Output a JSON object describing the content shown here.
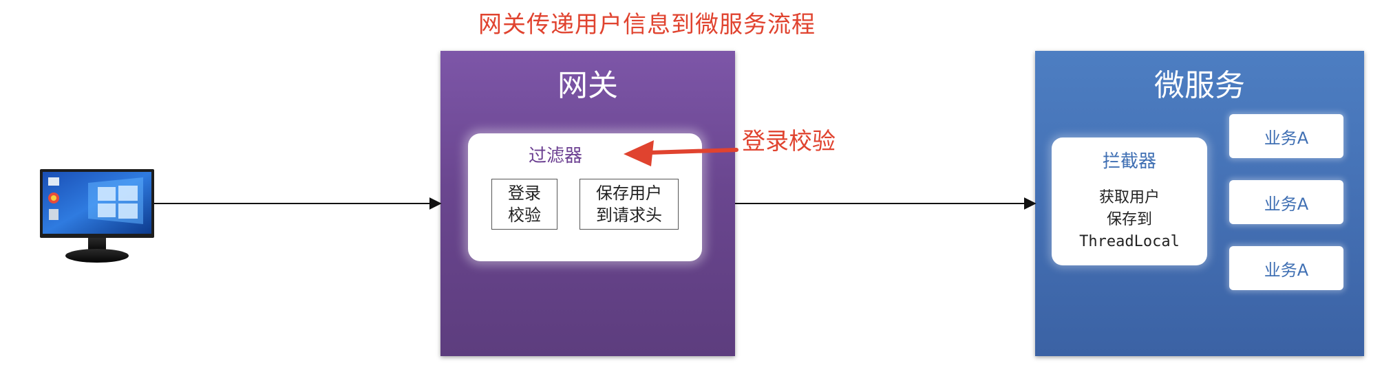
{
  "diagram": {
    "title": "网关传递用户信息到微服务流程",
    "gateway": {
      "title": "网关",
      "filter": {
        "title": "过滤器",
        "step_login_line1": "登录",
        "step_login_line2": "校验",
        "step_save_line1": "保存用户",
        "step_save_line2": "到请求头"
      }
    },
    "annotation": "登录校验",
    "microservice": {
      "title": "微服务",
      "interceptor": {
        "title": "拦截器",
        "line1": "获取用户",
        "line2": "保存到",
        "line3": "ThreadLocal"
      },
      "business": [
        "业务A",
        "业务A",
        "业务A"
      ]
    },
    "colors": {
      "annotation": "#e0432f",
      "gateway": "#6a468f",
      "microservice": "#4470b4"
    },
    "icons": {
      "client": "computer-monitor-icon"
    }
  }
}
